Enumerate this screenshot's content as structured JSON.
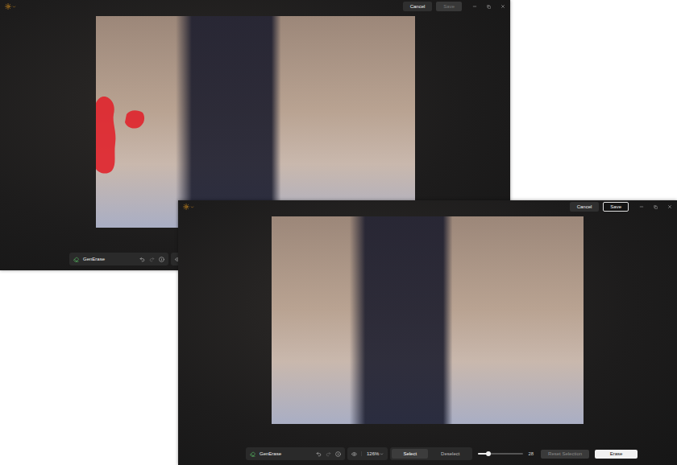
{
  "back_window": {
    "top_bar": {
      "cancel": "Cancel",
      "save": {
        "label": "Save",
        "disabled": true
      }
    },
    "tool": {
      "name": "GenErase"
    },
    "selection_mask": true
  },
  "front_window": {
    "top_bar": {
      "cancel": "Cancel",
      "save": {
        "label": "Save",
        "disabled": false
      }
    },
    "tool": {
      "name": "GenErase"
    },
    "zoom": "126%",
    "modes": [
      {
        "label": "Select",
        "selected": true
      },
      {
        "label": "Deselect",
        "selected": false
      }
    ],
    "brush": {
      "level": 0.23,
      "reading": "28"
    },
    "reset": {
      "label": "Reset Selection",
      "disabled": true
    },
    "erase": {
      "label": "Erase"
    },
    "selection_mask": false
  }
}
